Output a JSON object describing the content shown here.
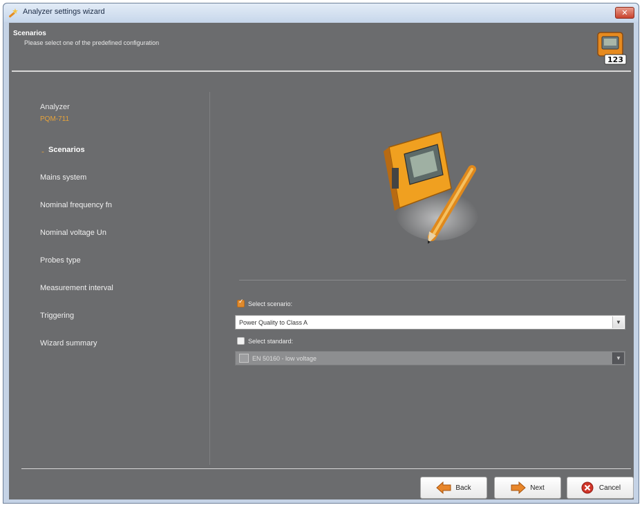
{
  "window": {
    "title": "Analyzer settings wizard",
    "close_label": "✕",
    "icon": "wizard-wand-icon"
  },
  "header": {
    "title": "Scenarios",
    "subtitle": "Please select one of the predefined configuration",
    "icon": "analyzer-step-icon",
    "icon_badge": "123"
  },
  "nav": {
    "analyzer_label": "Analyzer",
    "analyzer_model": "PQM-711",
    "active_bullet": "-",
    "items": [
      {
        "label": "Scenarios",
        "active": true
      },
      {
        "label": "Mains system",
        "active": false
      },
      {
        "label": "Nominal frequency fn",
        "active": false
      },
      {
        "label": "Nominal voltage Un",
        "active": false
      },
      {
        "label": "Probes type",
        "active": false
      },
      {
        "label": "Measurement interval",
        "active": false
      },
      {
        "label": "Triggering",
        "active": false
      },
      {
        "label": "Wizard summary",
        "active": false
      }
    ]
  },
  "main": {
    "hero_icon": "analyzer-with-pen-icon",
    "select_scenario": {
      "label": "Select scenario:",
      "checked": true,
      "value": "Power Quality to Class A"
    },
    "select_standard": {
      "label": "Select standard:",
      "checked": false,
      "value": "EN 50160 - low voltage"
    }
  },
  "footer": {
    "back_label": "Back",
    "next_label": "Next",
    "cancel_label": "Cancel"
  },
  "colors": {
    "panel_bg": "#6b6c6e",
    "accent": "#e08a2d",
    "window_frame": "#c5d3e6"
  }
}
